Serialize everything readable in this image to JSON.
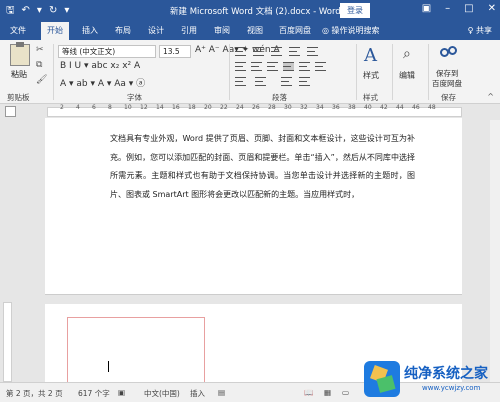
{
  "titlebar": {
    "title": "新建 Microsoft Word 文档 (2).docx - Word",
    "login_label": "登录",
    "qat": {
      "save": "🖫",
      "undo": "↶",
      "undo_drop": "▾",
      "redo": "↻",
      "customize": "▾"
    },
    "controls": {
      "restore": "▣",
      "minimize": "–",
      "maximize": "□",
      "close": "✕"
    }
  },
  "tabs": [
    {
      "label": "文件"
    },
    {
      "label": "开始"
    },
    {
      "label": "插入"
    },
    {
      "label": "布局"
    },
    {
      "label": "设计"
    },
    {
      "label": "引用"
    },
    {
      "label": "审阅"
    },
    {
      "label": "视图"
    },
    {
      "label": "百度网盘"
    },
    {
      "label": "操作说明搜索"
    }
  ],
  "share_label": "♀ 共享",
  "ribbon": {
    "paste_label": "粘贴",
    "clipboard_label": "剪贴板",
    "font_name": "等线 (中文正文)",
    "font_size": "13.5",
    "font_label": "字体",
    "paragraph_label": "段落",
    "styles_label": "样式",
    "editing_label": "编辑",
    "save_to_label_1": "保存到",
    "save_to_label_2": "百度网盘",
    "save_label": "保存",
    "format_row1": "A⁺ A⁻ Aa▾ ✦ wén A",
    "format_row2": "B  I  U ▾ abc x₂ x²  A",
    "format_row3": "A ▾ ab ▾ A ▾ Aa ▾ ⓐ",
    "style_icon": "A",
    "edit_icon": "⌕",
    "collapse": "^"
  },
  "ruler_numbers": [
    "2",
    "4",
    "6",
    "8",
    "10",
    "12",
    "14",
    "16",
    "18",
    "20",
    "22",
    "24",
    "26",
    "28",
    "30",
    "32",
    "34",
    "36",
    "38",
    "40",
    "42",
    "44",
    "46",
    "48"
  ],
  "document": {
    "paragraph": "文档具有专业外观，Word 提供了页眉、页脚、封面和文本框设计，这些设计可互为补充。例如，您可以添加匹配的封面、页眉和提要栏。单击“插入”，然后从不同库中选择所需元素。主题和样式也有助于文档保持协调。当您单击设计并选择新的主题时，图片、图表或 SmartArt 图形将会更改以匹配新的主题。当应用样式时，"
  },
  "status": {
    "page": "第 2 页，共 2 页",
    "words": "617 个字",
    "lang": "中文(中国)",
    "mode": "插入"
  },
  "watermark": {
    "title": "纯净系统之家",
    "url": "www.ycwjzy.com"
  },
  "colors": {
    "accent": "#2b579a",
    "brand": "#1660c2"
  }
}
